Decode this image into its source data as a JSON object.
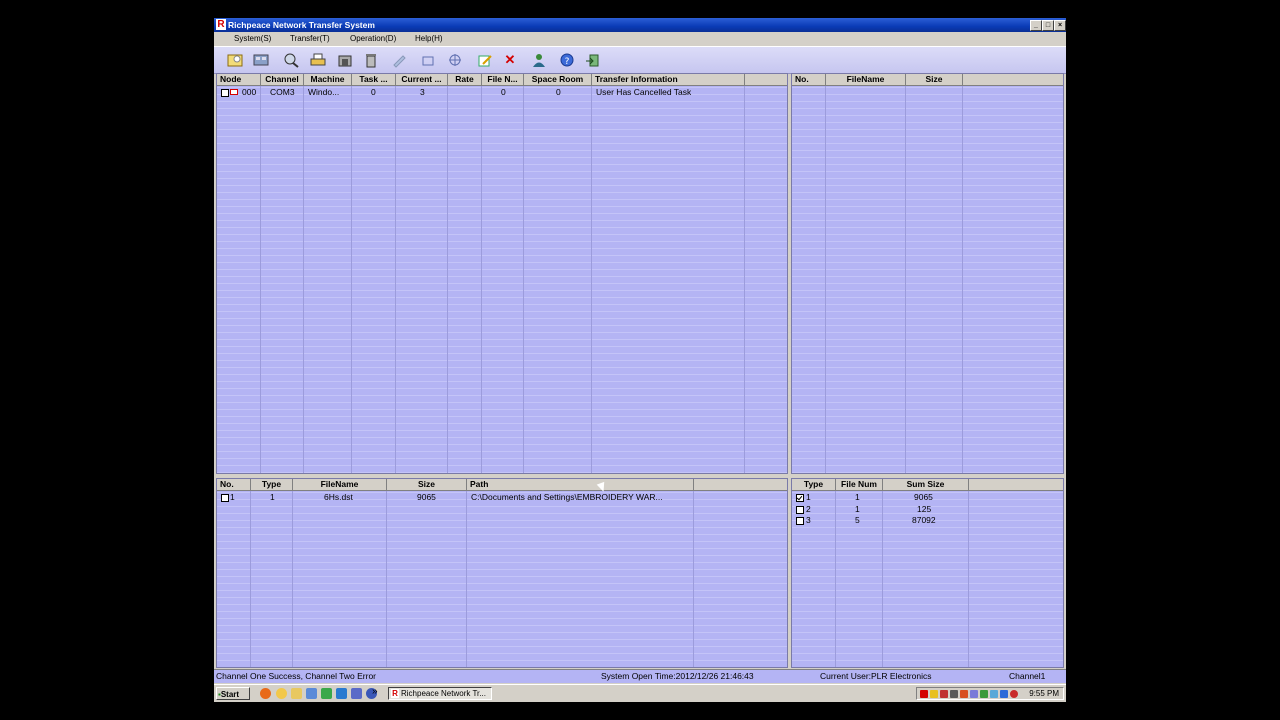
{
  "window": {
    "title": "Richpeace Network Transfer System",
    "app_icon": "R",
    "controls": {
      "minimize": "_",
      "maximize": "□",
      "close": "×"
    }
  },
  "menu": [
    "System(S)",
    "Transfer(T)",
    "Operation(D)",
    "Help(H)"
  ],
  "toolbar_icons": [
    "open-icon",
    "network-icon",
    "search-icon",
    "printer-icon",
    "transfer-icon",
    "delete-icon",
    "select-icon",
    "frame-icon",
    "target-icon",
    "edit-icon",
    "cancel-icon",
    "user-icon",
    "help-icon",
    "exit-icon"
  ],
  "nodes_table": {
    "columns": [
      "Node",
      "Channel",
      "Machine",
      "Task ...",
      "Current ...",
      "Rate",
      "File N...",
      "Space Room",
      "Transfer Information"
    ],
    "rows": [
      {
        "node": "000",
        "channel": "COM3",
        "machine": "Windo...",
        "task": "0",
        "current": "3",
        "rate": "",
        "file_n": "0",
        "space_room": "0",
        "info": "User Has Cancelled Task"
      }
    ]
  },
  "files_right_table": {
    "columns": [
      "No.",
      "FileName",
      "Size"
    ],
    "rows": []
  },
  "tasks_table": {
    "columns": [
      "No.",
      "Type",
      "FileName",
      "Size",
      "Path"
    ],
    "rows": [
      {
        "no": "1",
        "type": "1",
        "filename": "6Hs.dst",
        "size": "9065",
        "path": "C:\\Documents and Settings\\EMBROIDERY WAR..."
      }
    ]
  },
  "types_table": {
    "columns": [
      "Type",
      "File Num",
      "Sum Size"
    ],
    "rows": [
      {
        "type": "1",
        "file_num": "1",
        "sum_size": "9065",
        "checked": true
      },
      {
        "type": "2",
        "file_num": "1",
        "sum_size": "125",
        "checked": false
      },
      {
        "type": "3",
        "file_num": "5",
        "sum_size": "87092",
        "checked": false
      }
    ]
  },
  "status": {
    "message": "Channel One Success, Channel Two Error",
    "open_time": "System Open Time:2012/12/26  21:46:43",
    "current_user": "Current User:PLR Electronics",
    "channel": "Channel1"
  },
  "taskbar": {
    "start": "Start",
    "chevron": "»",
    "task_button": "Richpeace Network Tr...",
    "clock": "9:55 PM"
  },
  "colors": {
    "pane": "#b4b4f4",
    "title": "#0a3bb6",
    "cancel": "#d40000"
  }
}
